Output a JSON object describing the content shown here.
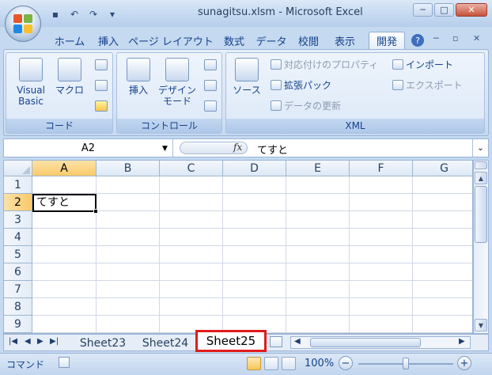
{
  "window": {
    "title": "sunagitsu.xlsm - Microsoft Excel",
    "controls": [
      "minimize-icon",
      "maximize-icon",
      "close-icon"
    ]
  },
  "quick_access": [
    "save-icon",
    "undo-icon",
    "redo-icon",
    "customize-icon"
  ],
  "ribbon_tabs": [
    {
      "label": "ホーム"
    },
    {
      "label": "挿入"
    },
    {
      "label": "ページ レイアウト"
    },
    {
      "label": "数式"
    },
    {
      "label": "データ"
    },
    {
      "label": "校閲"
    },
    {
      "label": "表示"
    },
    {
      "label": "開発",
      "active": true
    }
  ],
  "ribbon": {
    "groups": {
      "code": {
        "label": "コード",
        "visual_basic": "Visual\nBasic",
        "visual_basic_l1": "Visual",
        "visual_basic_l2": "Basic",
        "macro": "マクロ"
      },
      "control": {
        "label": "コントロール",
        "insert": "挿入",
        "design_mode_l1": "デザイン",
        "design_mode_l2": "モード"
      },
      "xml": {
        "label": "XML",
        "source": "ソース",
        "map_properties": "対応付けのプロパティ",
        "expansion_pack": "拡張パック",
        "refresh_data": "データの更新",
        "import": "インポート",
        "export": "エクスポート"
      }
    }
  },
  "formula_bar": {
    "name_box": "A2",
    "fx_label": "fx",
    "formula": "てすと"
  },
  "grid": {
    "columns": [
      "A",
      "B",
      "C",
      "D",
      "E",
      "F",
      "G"
    ],
    "rows": [
      "1",
      "2",
      "3",
      "4",
      "5",
      "6",
      "7",
      "8",
      "9"
    ],
    "active_cell": "A2",
    "cells": {
      "A2": "てすと"
    }
  },
  "sheet_tabs": [
    "Sheet23",
    "Sheet24",
    "Sheet25"
  ],
  "active_sheet": "Sheet25",
  "status_bar": {
    "mode": "コマンド",
    "zoom": "100%"
  },
  "colors": {
    "accent": "#15428b",
    "highlight_box": "#e21b1b",
    "selected_header": "#f9c96a"
  }
}
